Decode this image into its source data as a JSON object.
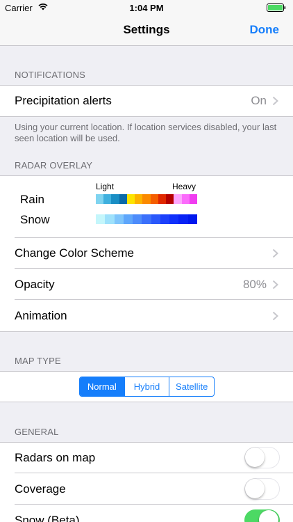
{
  "status_bar": {
    "carrier": "Carrier",
    "time": "1:04 PM",
    "wifi_icon": "wifi-icon",
    "battery_icon": "battery-icon",
    "battery_color": "#4cd964"
  },
  "nav": {
    "title": "Settings",
    "done_label": "Done"
  },
  "notifications": {
    "header": "NOTIFICATIONS",
    "precipitation_alerts": {
      "label": "Precipitation alerts",
      "value": "On"
    },
    "footer": "Using your current location. If location services disabled, your last seen location will be used."
  },
  "radar_overlay": {
    "header": "RADAR OVERLAY",
    "legend": {
      "light_label": "Light",
      "heavy_label": "Heavy",
      "rain_label": "Rain",
      "snow_label": "Snow",
      "rain_colors": [
        "#7fd4f0",
        "#3fb0de",
        "#1a8ec4",
        "#0a6aa8",
        "#fde400",
        "#fdb300",
        "#fb8a00",
        "#f55e00",
        "#e02800",
        "#b40000",
        "#fda6fd",
        "#fb6bfb",
        "#f03cf0"
      ],
      "snow_colors": [
        "#c4f6fb",
        "#9ee1fb",
        "#7fc5fb",
        "#5ea6fb",
        "#4d8cfb",
        "#3b70fb",
        "#2a58fb",
        "#1c40fb",
        "#1030fb",
        "#0822f5",
        "#0018ee"
      ]
    },
    "change_color_scheme": {
      "label": "Change Color Scheme"
    },
    "opacity": {
      "label": "Opacity",
      "value": "80%"
    },
    "animation": {
      "label": "Animation"
    }
  },
  "map_type": {
    "header": "MAP TYPE",
    "options": [
      "Normal",
      "Hybrid",
      "Satellite"
    ],
    "selected": "Normal"
  },
  "general": {
    "header": "GENERAL",
    "radars_on_map": {
      "label": "Radars on map",
      "on": false
    },
    "coverage": {
      "label": "Coverage",
      "on": false
    },
    "snow_beta": {
      "label": "Snow (Beta)",
      "on": true
    }
  },
  "colors": {
    "accent": "#157efb",
    "toggle_on": "#4cd964",
    "background": "#efeff4"
  }
}
